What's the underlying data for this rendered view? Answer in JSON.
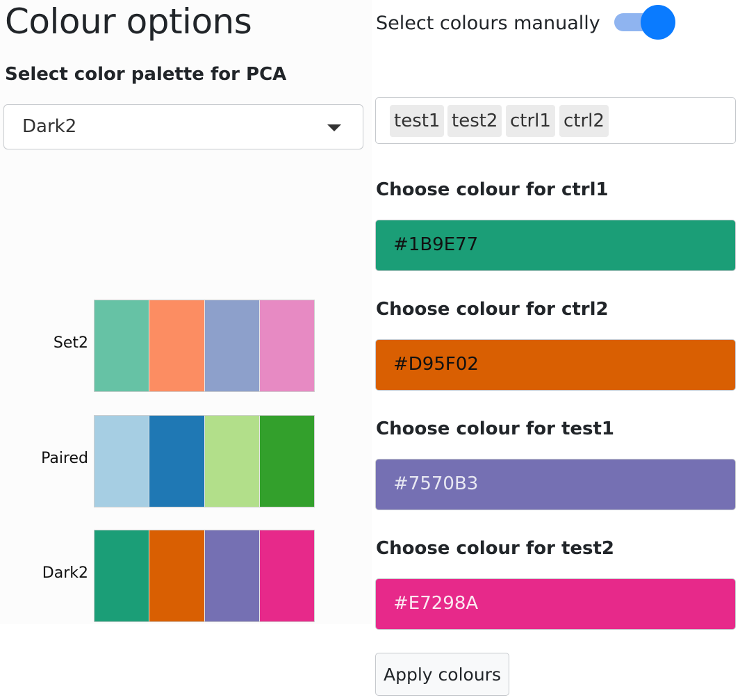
{
  "header": {
    "title": "Colour options",
    "manual_toggle_label": "Select colours manually",
    "manual_toggle_on": true
  },
  "palette_select": {
    "label": "Select color palette for PCA",
    "value": "Dark2"
  },
  "samples": {
    "tags": [
      "test1",
      "test2",
      "ctrl1",
      "ctrl2"
    ]
  },
  "palette_preview": [
    {
      "name": "Set2",
      "colors": [
        "#66C2A5",
        "#FC8D62",
        "#8DA0CB",
        "#E78AC3"
      ]
    },
    {
      "name": "Paired",
      "colors": [
        "#A6CEE3",
        "#1F78B4",
        "#B2DF8A",
        "#33A02C"
      ]
    },
    {
      "name": "Dark2",
      "colors": [
        "#1B9E77",
        "#D95F02",
        "#7570B3",
        "#E7298A"
      ]
    }
  ],
  "colour_pickers": [
    {
      "label": "Choose colour for ctrl1",
      "value": "#1B9E77",
      "text_color": "#111111"
    },
    {
      "label": "Choose colour for ctrl2",
      "value": "#D95F02",
      "text_color": "#111111"
    },
    {
      "label": "Choose colour for test1",
      "value": "#7570B3",
      "text_color": "#e8e8f2"
    },
    {
      "label": "Choose colour for test2",
      "value": "#E7298A",
      "text_color": "#fbe8f1"
    }
  ],
  "actions": {
    "apply_label": "Apply colours"
  },
  "theme": {
    "toggle_accent": "#0a7bff",
    "toggle_track": "#8fb4f0"
  }
}
